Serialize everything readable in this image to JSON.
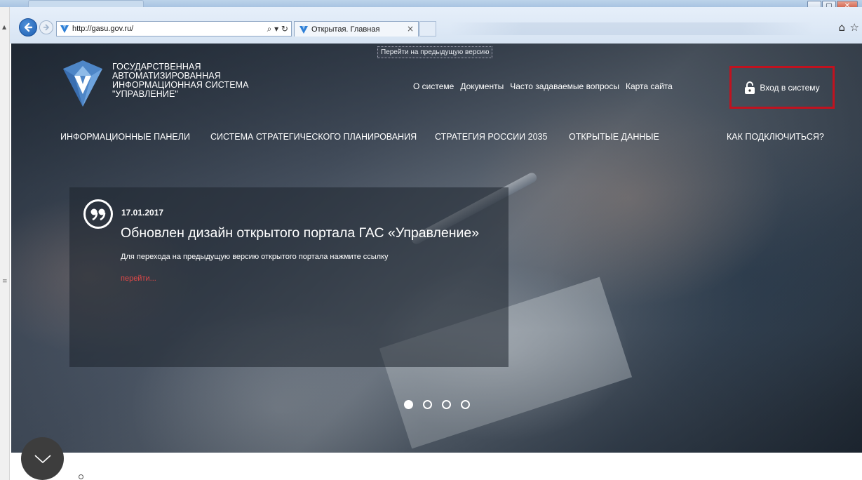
{
  "browser": {
    "url": "http://gasu.gov.ru/",
    "tab_title": "Открытая. Главная",
    "search_glyph": "⌕ ▾ ↻",
    "tab_close": "×",
    "home_icon": "⌂",
    "favorites_icon": "☆",
    "window_controls": {
      "minimize": "▁",
      "maximize": "▢",
      "close": "✕"
    },
    "gutter_arrow": "▲",
    "gutter_grip": "≡"
  },
  "site": {
    "prev_version_link": "Перейти на предыдущую версию",
    "brand_lines": [
      "ГОСУДАРСТВЕННАЯ",
      "АВТОМАТИЗИРОВАННАЯ",
      "ИНФОРМАЦИОННАЯ СИСТЕМА",
      "\"УПРАВЛЕНИЕ\""
    ],
    "top_nav": [
      "О системе",
      "Документы",
      "Часто задаваемые вопросы",
      "Карта сайта"
    ],
    "login_label": "Вход в систему",
    "main_nav": [
      "ИНФОРМАЦИОННЫЕ ПАНЕЛИ",
      "СИСТЕМА СТРАТЕГИЧЕСКОГО ПЛАНИРОВАНИЯ",
      "СТРАТЕГИЯ РОССИИ 2035",
      "ОТКРЫТЫЕ ДАННЫЕ",
      "КАК ПОДКЛЮЧИТЬСЯ?"
    ]
  },
  "news": {
    "date": "17.01.2017",
    "title": "Обновлен дизайн открытого портала ГАС «Управление»",
    "text": "Для перехода на предыдущую версию открытого портала нажмите ссылку",
    "link": "перейти..."
  },
  "carousel": {
    "count": 4,
    "active_index": 0
  },
  "colors": {
    "login_border": "#c1121f",
    "link_red": "#e04848",
    "ie_blue": "#1d5fb3"
  }
}
